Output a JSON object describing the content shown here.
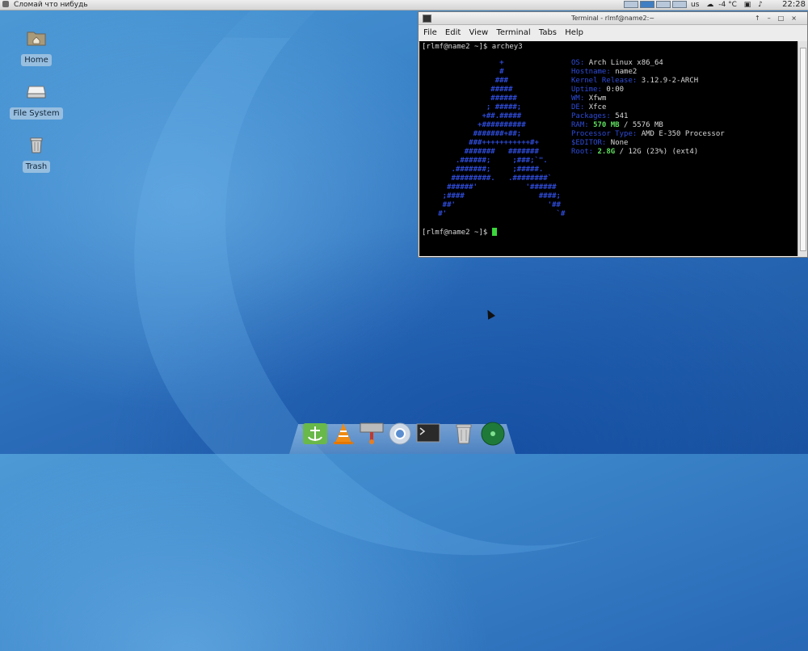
{
  "top_panel": {
    "applications_label": "Сломай что нибудь",
    "tray": {
      "temperature": "-4 °C",
      "keyboard": "us"
    },
    "clock": "22:28",
    "workspaces": 4
  },
  "desktop_icons": [
    {
      "label": "Home",
      "icon": "home-folder-icon"
    },
    {
      "label": "File System",
      "icon": "drive-icon"
    },
    {
      "label": "Trash",
      "icon": "trash-icon"
    }
  ],
  "terminal": {
    "title": "Terminal - rlmf@name2:~",
    "menu": [
      "File",
      "Edit",
      "View",
      "Terminal",
      "Tabs",
      "Help"
    ],
    "prompt1": "[rlmf@name2 ~]$ archey3",
    "prompt2": "[rlmf@name2 ~]$ ",
    "info": [
      {
        "key": "OS:",
        "value": "Arch Linux x86_64"
      },
      {
        "key": "Hostname:",
        "value": "name2"
      },
      {
        "key": "Kernel Release:",
        "value": "3.12.9-2-ARCH"
      },
      {
        "key": "Uptime:",
        "value": "0:00"
      },
      {
        "key": "WM:",
        "value": "Xfwm"
      },
      {
        "key": "DE:",
        "value": "Xfce"
      },
      {
        "key": "Packages:",
        "value": "541"
      },
      {
        "key": "RAM:",
        "value_hl": "570 MB",
        "value": " / 5576 MB"
      },
      {
        "key": "Processor Type:",
        "value": "AMD E-350 Processor"
      },
      {
        "key": "$EDITOR:",
        "value": "None"
      },
      {
        "key": "Root:",
        "value_hl": "2.8G",
        "value": " / 12G (23%) (ext4)"
      }
    ],
    "ascii_art": [
      "                 +",
      "                 #",
      "                ###",
      "               #####",
      "               ######",
      "              ; #####;",
      "             +##.#####",
      "            +##########",
      "           #######+##;",
      "          ###+++++++++++#+",
      "         #######   #######",
      "       .######;     ;###;`\".",
      "      .#######;     ;#####.",
      "      #########.   .########`",
      "     ######'           '######",
      "    ;####                 ####;",
      "    ##'                     '##",
      "   #'                         `#"
    ]
  },
  "dock": [
    "anchor-icon",
    "vlc-cone-icon",
    "settings-tool-icon",
    "browser-icon",
    "terminal-icon",
    "trash-icon",
    "globe-icon"
  ]
}
